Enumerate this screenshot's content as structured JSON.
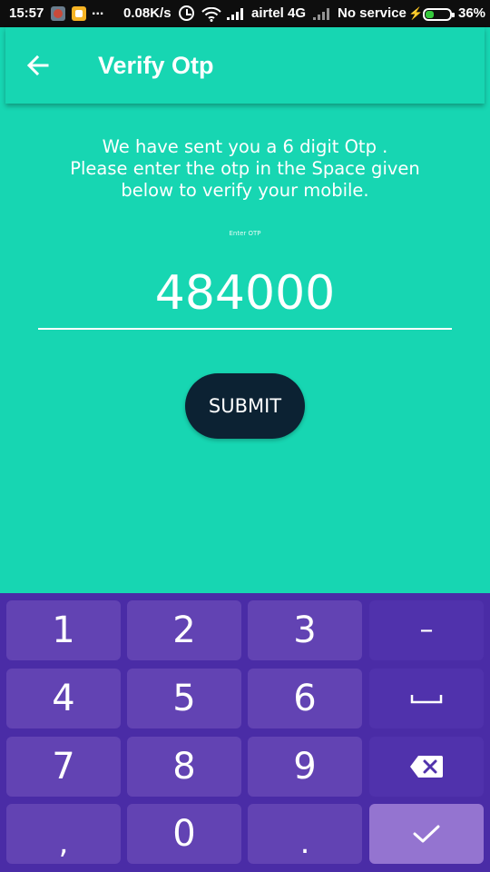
{
  "status_bar": {
    "time": "15:57",
    "more": "...",
    "speed": "0.08K/s",
    "carrier": "airtel 4G",
    "no_service": "No service",
    "battery_percent": "36%",
    "battery_level": 0.36,
    "icons": [
      "app-notification-icon",
      "app-notification-icon",
      "alarm-icon",
      "wifi-icon",
      "signal-icon",
      "signal-icon",
      "charging-icon",
      "battery-icon"
    ]
  },
  "app_bar": {
    "title": "Verify Otp",
    "back_icon": "arrow-left-icon"
  },
  "main": {
    "instruction_lines": [
      "We have sent you a 6 digit Otp .",
      "Please enter the otp in the Space given",
      "below to verify your mobile."
    ],
    "otp_label": "Enter OTP",
    "otp_value": "484000",
    "submit_label": "SUBMIT"
  },
  "keyboard": {
    "keys": [
      "1",
      "2",
      "3",
      "–",
      "4",
      "5",
      "6",
      "space",
      "7",
      "8",
      "9",
      "backspace",
      ",",
      "0",
      ".",
      "done"
    ],
    "labels": {
      "k1": "1",
      "k2": "2",
      "k3": "3",
      "dash": "–",
      "k4": "4",
      "k5": "5",
      "k6": "6",
      "k7": "7",
      "k8": "8",
      "k9": "9",
      "comma": ",",
      "k0": "0",
      "dot": "."
    },
    "icons": {
      "space": "space-bar-icon",
      "backspace": "backspace-icon",
      "done": "checkmark-icon"
    }
  },
  "colors": {
    "primary": "#17d6b2",
    "submit_button": "#0c2233",
    "keyboard_bg": "#4a2ca6",
    "key_bg": "#6243b3",
    "key_done": "#9474d0",
    "battery_fill": "#35c93c"
  }
}
